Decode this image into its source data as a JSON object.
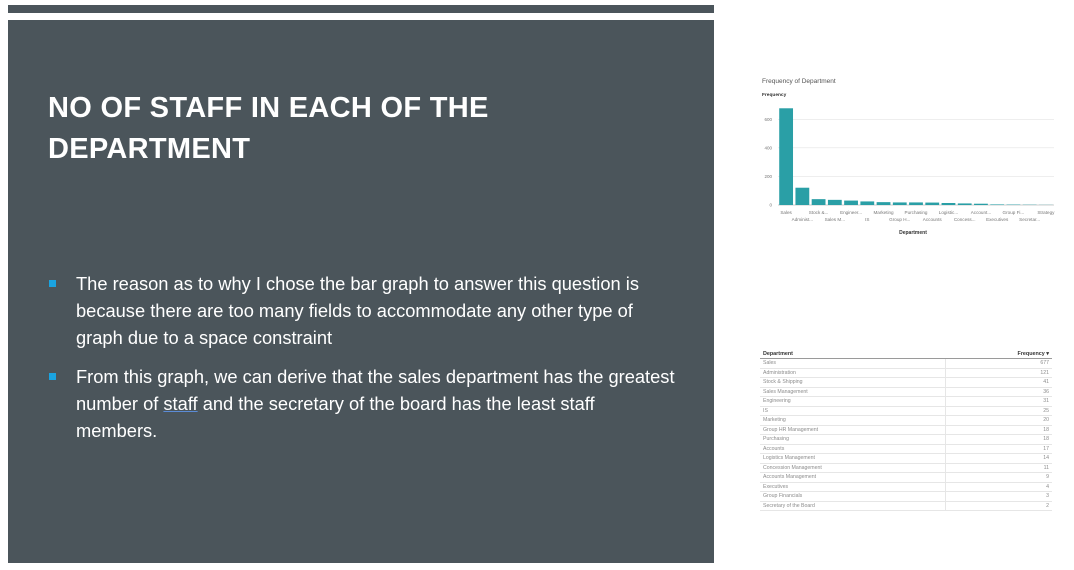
{
  "slide": {
    "title": "NO OF STAFF IN EACH OF THE DEPARTMENT",
    "bullets": [
      {
        "text": "The reason as to why I chose the bar graph to answer this question is because there are too many fields to accommodate any other type of graph due to a space constraint"
      },
      {
        "before": "From this graph, we can derive that the sales department has the greatest number of ",
        "underlined": "staff",
        "after": " and the secretary of the board has the least staff members."
      }
    ],
    "bullet_color": "#1aa3e0",
    "background": "#4b555b"
  },
  "chart_data": {
    "type": "bar",
    "title": "Frequency of Department",
    "ylabel": "Frequency",
    "xlabel": "Department",
    "ylim": [
      0,
      700
    ],
    "yticks": [
      0,
      200,
      400,
      600
    ],
    "grid": true,
    "bar_color": "#2a9fa6",
    "categories": [
      "Sales",
      "Administration",
      "Stock & Shipping",
      "Sales Management",
      "Engineering",
      "IS",
      "Marketing",
      "Group HR Management",
      "Purchasing",
      "Accounts",
      "Logistics Management",
      "Concession Management",
      "Accounts Management",
      "Executives",
      "Group Financials",
      "Secretary of the Board",
      "Strategy"
    ],
    "tick_labels_top": [
      "Sales",
      "Stock &...",
      "Engineer...",
      "Marketing",
      "Purchasing",
      "Logistic...",
      "Account...",
      "Group Fi...",
      "Strategy"
    ],
    "tick_labels_bottom": [
      "Administ...",
      "Sales M...",
      "IS",
      "Group H...",
      "Accounts",
      "Concess...",
      "Executives",
      "Secretar..."
    ],
    "values": [
      677,
      121,
      41,
      36,
      31,
      25,
      20,
      18,
      18,
      17,
      14,
      11,
      9,
      4,
      3,
      2,
      1
    ]
  },
  "table": {
    "headers": [
      "Department",
      "Frequency ▾"
    ],
    "rows": [
      [
        "Sales",
        "677"
      ],
      [
        "Administration",
        "121"
      ],
      [
        "Stock & Shipping",
        "41"
      ],
      [
        "Sales Management",
        "36"
      ],
      [
        "Engineering",
        "31"
      ],
      [
        "IS",
        "25"
      ],
      [
        "Marketing",
        "20"
      ],
      [
        "Group HR Management",
        "18"
      ],
      [
        "Purchasing",
        "18"
      ],
      [
        "Accounts",
        "17"
      ],
      [
        "Logistics Management",
        "14"
      ],
      [
        "Concession Management",
        "11"
      ],
      [
        "Accounts Management",
        "9"
      ],
      [
        "Executives",
        "4"
      ],
      [
        "Group Financials",
        "3"
      ],
      [
        "Secretary of the Board",
        "2"
      ]
    ]
  }
}
